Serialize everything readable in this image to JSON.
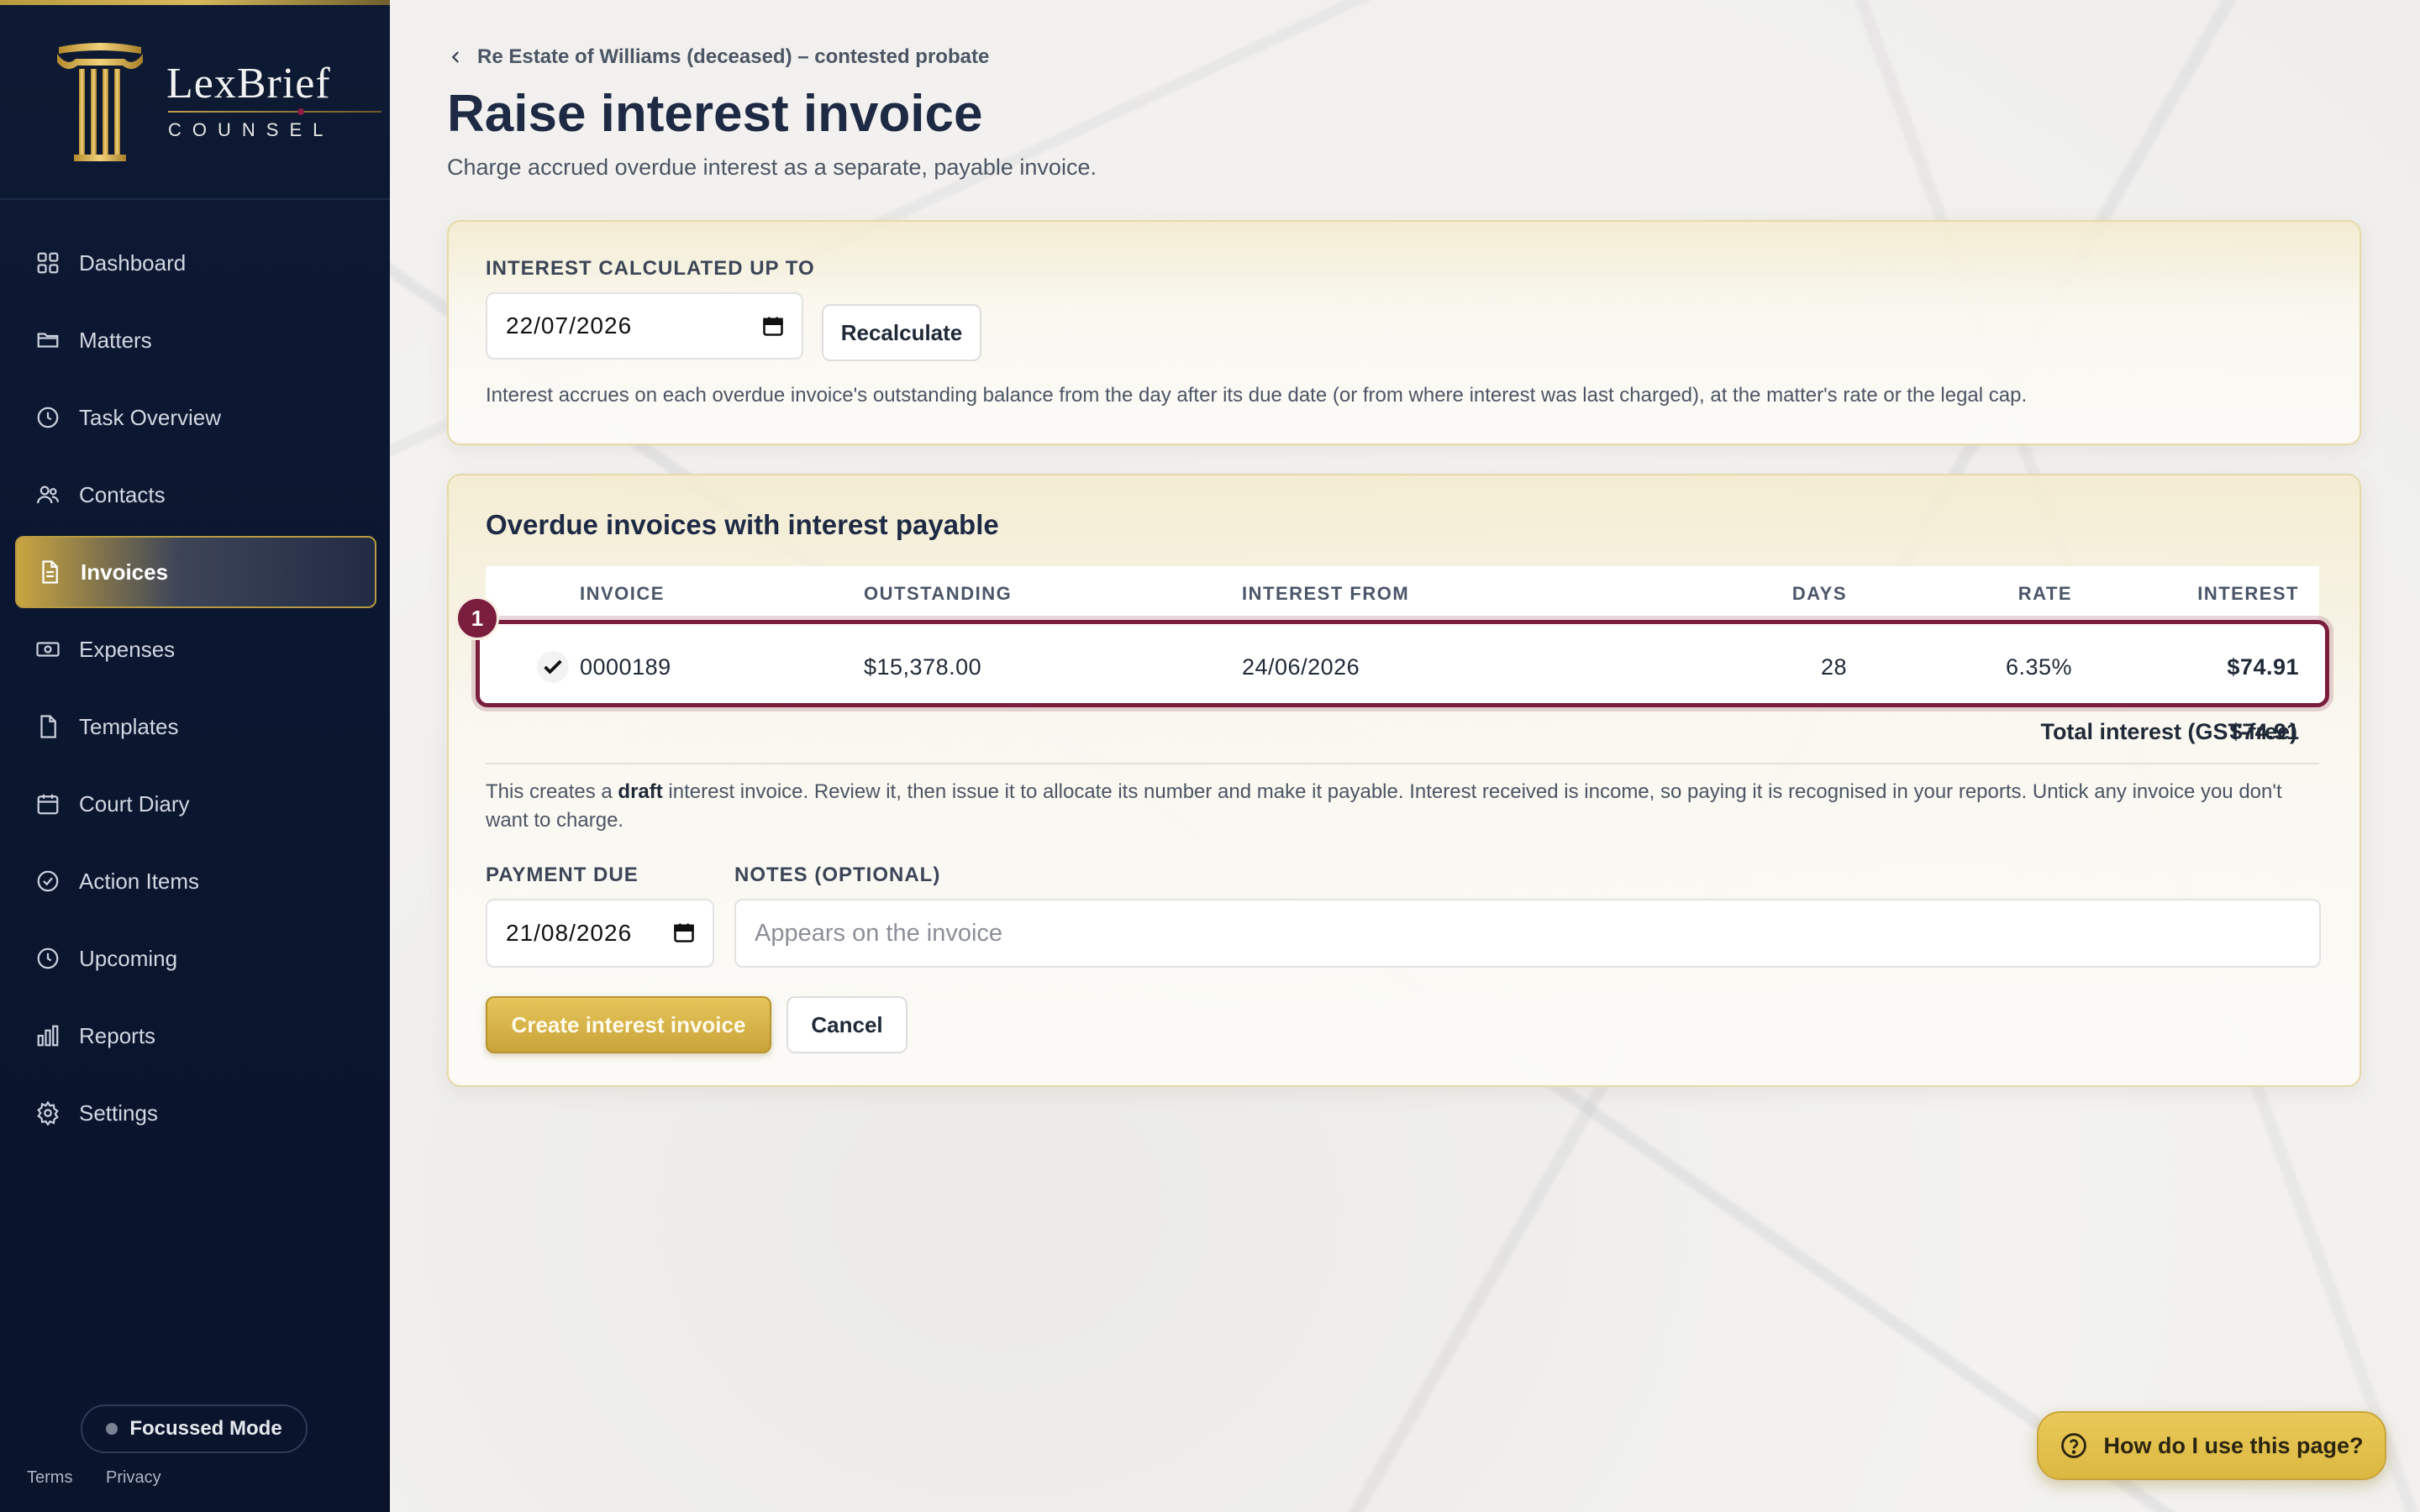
{
  "app": {
    "brand": "LexBrief",
    "brand_sub": "COUNSEL"
  },
  "sidebar": {
    "items": [
      {
        "label": "Dashboard",
        "icon": "grid-icon"
      },
      {
        "label": "Matters",
        "icon": "folder-icon"
      },
      {
        "label": "Task Overview",
        "icon": "clock-icon"
      },
      {
        "label": "Contacts",
        "icon": "users-icon"
      },
      {
        "label": "Invoices",
        "icon": "file-text-icon",
        "active": true
      },
      {
        "label": "Expenses",
        "icon": "banknote-icon"
      },
      {
        "label": "Templates",
        "icon": "file-icon"
      },
      {
        "label": "Court Diary",
        "icon": "calendar-icon"
      },
      {
        "label": "Action Items",
        "icon": "check-circle-icon"
      },
      {
        "label": "Upcoming",
        "icon": "clock-icon"
      },
      {
        "label": "Reports",
        "icon": "bar-chart-icon"
      },
      {
        "label": "Settings",
        "icon": "gear-icon"
      }
    ],
    "focus_mode": "Focussed Mode",
    "terms": "Terms",
    "privacy": "Privacy"
  },
  "page": {
    "breadcrumb": "Re Estate of Williams (deceased) – contested probate",
    "title": "Raise interest invoice",
    "subtitle": "Charge accrued overdue interest as a separate, payable invoice."
  },
  "calc": {
    "label": "INTEREST CALCULATED UP TO",
    "date": "22/07/2026",
    "recalc_button": "Recalculate",
    "help": "Interest accrues on each overdue invoice's outstanding balance from the day after its due date (or from where interest was last charged), at the matter's rate or the legal cap."
  },
  "overdue": {
    "title": "Overdue invoices with interest payable",
    "columns": {
      "invoice": "INVOICE",
      "outstanding": "OUTSTANDING",
      "interest_from": "INTEREST FROM",
      "days": "DAYS",
      "rate": "RATE",
      "interest": "INTEREST"
    },
    "rows": [
      {
        "invoice": "0000189",
        "outstanding": "$15,378.00",
        "interest_from": "24/06/2026",
        "days": "28",
        "rate": "6.35%",
        "interest": "$74.91",
        "checked": true
      }
    ],
    "row_badge": "1",
    "total_label": "Total interest (GST-free)",
    "total_value": "$74.91",
    "note_pre": "This creates a ",
    "note_bold": "draft",
    "note_post": " interest invoice. Review it, then issue it to allocate its number and make it payable. Interest received is income, so paying it is recognised in your reports. Untick any invoice you don't want to charge.",
    "payment_due_label": "PAYMENT DUE",
    "payment_due": "21/08/2026",
    "notes_label": "NOTES (OPTIONAL)",
    "notes_placeholder": "Appears on the invoice",
    "create_button": "Create interest invoice",
    "cancel_button": "Cancel"
  },
  "help_button": "How do I use this page?",
  "colors": {
    "sidebar_bg": "#0e1a33",
    "accent_gold": "#d4b04a",
    "highlight_maroon": "#7b1d3d"
  }
}
